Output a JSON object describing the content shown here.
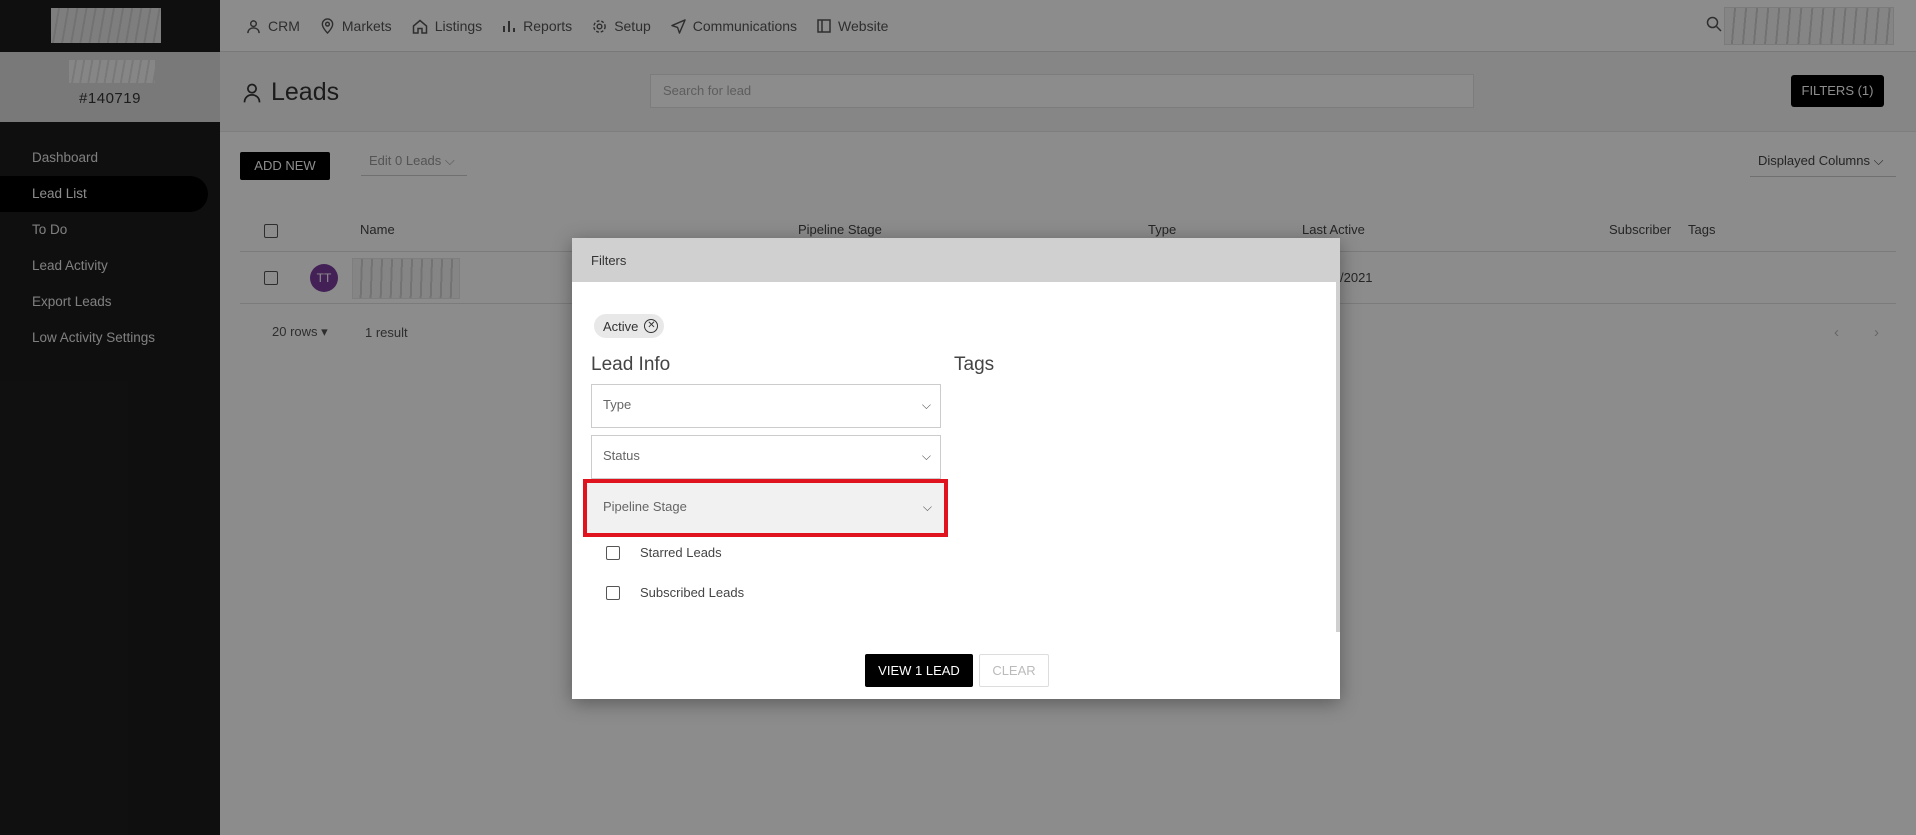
{
  "sidebar": {
    "account_id": "#140719",
    "items": [
      {
        "label": "Dashboard"
      },
      {
        "label": "Lead List"
      },
      {
        "label": "To Do"
      },
      {
        "label": "Lead Activity"
      },
      {
        "label": "Export Leads"
      },
      {
        "label": "Low Activity Settings"
      }
    ],
    "active_item": "Lead List"
  },
  "topnav": {
    "items": [
      {
        "label": "CRM",
        "icon": "person-icon"
      },
      {
        "label": "Markets",
        "icon": "map-pin-icon"
      },
      {
        "label": "Listings",
        "icon": "home-icon"
      },
      {
        "label": "Reports",
        "icon": "bar-chart-icon"
      },
      {
        "label": "Setup",
        "icon": "gear-icon"
      },
      {
        "label": "Communications",
        "icon": "send-icon"
      },
      {
        "label": "Website",
        "icon": "layout-icon"
      }
    ]
  },
  "page": {
    "title": "Leads",
    "search_placeholder": "Search for lead",
    "filters_button": "FILTERS (1)",
    "add_new": "ADD NEW",
    "edit_leads": "Edit 0 Leads",
    "displayed_columns": "Displayed Columns"
  },
  "table": {
    "columns": [
      "Name",
      "Pipeline Stage",
      "Type",
      "Last Active",
      "Subscriber",
      "Tags"
    ],
    "rows": [
      {
        "initials": "TT",
        "last_active_partial": "/2021"
      }
    ],
    "rows_per_page": "20 rows",
    "result_count": "1 result"
  },
  "modal": {
    "title": "Filters",
    "active_chip": "Active",
    "lead_info_title": "Lead Info",
    "tags_title": "Tags",
    "selects": {
      "type": "Type",
      "status": "Status",
      "pipeline_stage": "Pipeline Stage"
    },
    "checkboxes": {
      "starred": "Starred Leads",
      "subscribed": "Subscribed Leads"
    },
    "view_button": "VIEW 1 LEAD",
    "clear_button": "CLEAR"
  },
  "colors": {
    "highlight": "#e0141f",
    "avatar": "#7b3d9e",
    "sidebar_bg": "#1d1d1d"
  }
}
